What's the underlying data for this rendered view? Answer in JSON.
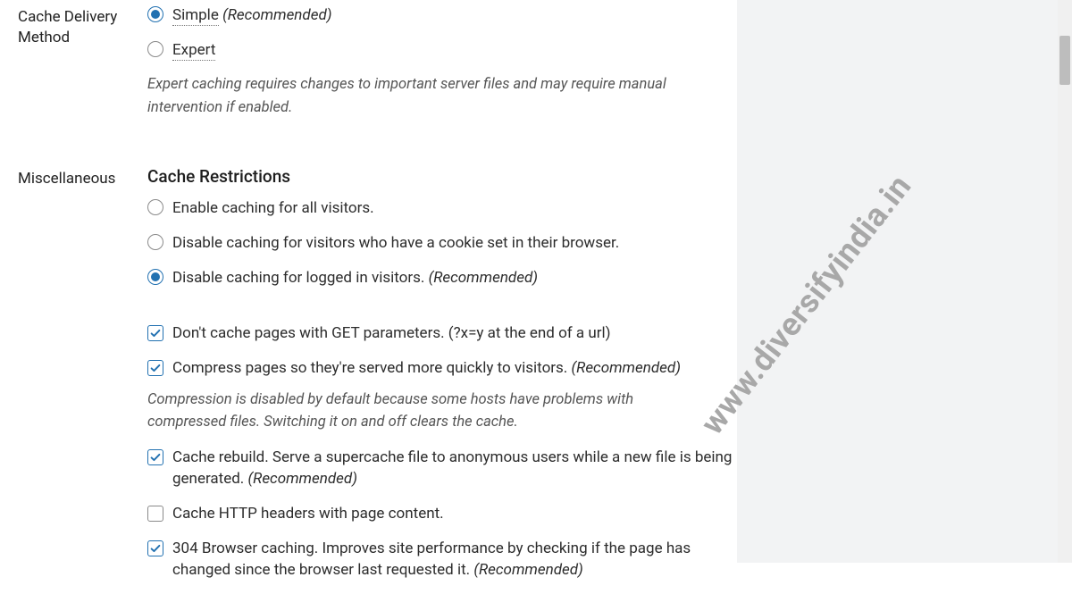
{
  "sections": {
    "delivery": {
      "label": "Cache Delivery Method",
      "options": {
        "simple": {
          "label": "Simple",
          "rec": "(Recommended)"
        },
        "expert": {
          "label": "Expert"
        }
      },
      "help": "Expert caching requires changes to important server files and may require manual intervention if enabled."
    },
    "misc": {
      "label": "Miscellaneous",
      "subheading": "Cache Restrictions",
      "restrictions": {
        "all": "Enable caching for all visitors.",
        "cookie": "Disable caching for visitors who have a cookie set in their browser.",
        "loggedin": {
          "label": "Disable caching for logged in visitors.",
          "rec": "(Recommended)"
        }
      },
      "options": {
        "get": "Don't cache pages with GET parameters. (?x=y at the end of a url)",
        "compress": {
          "label": "Compress pages so they're served more quickly to visitors.",
          "rec": "(Recommended)"
        },
        "compress_help": "Compression is disabled by default because some hosts have problems with compressed files. Switching it on and off clears the cache.",
        "rebuild": {
          "label": "Cache rebuild. Serve a supercache file to anonymous users while a new file is being generated.",
          "rec": "(Recommended)"
        },
        "http_headers": "Cache HTTP headers with page content.",
        "b304": {
          "label": "304 Browser caching. Improves site performance by checking if the page has changed since the browser last requested it.",
          "rec": "(Recommended)"
        }
      }
    }
  },
  "watermark": "www.diversifyindia.in"
}
